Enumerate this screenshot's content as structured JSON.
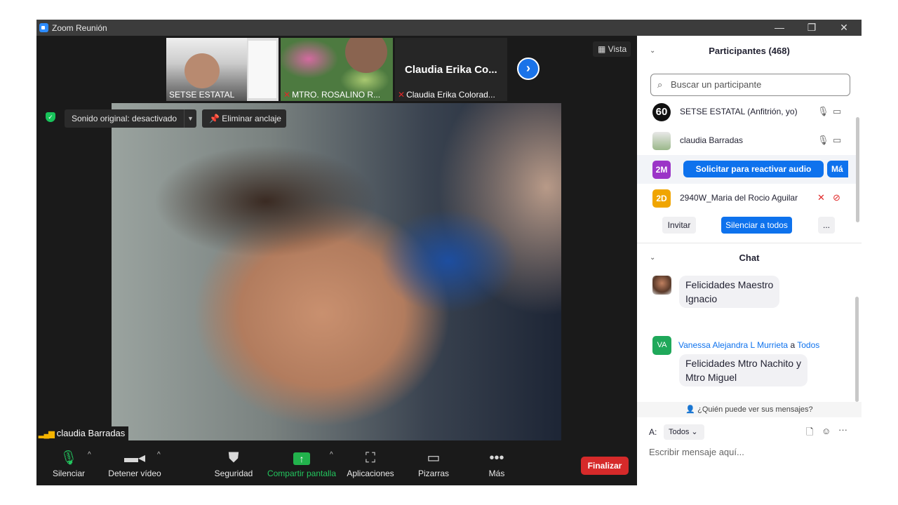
{
  "window": {
    "title": "Zoom Reunión",
    "minimize": "—",
    "restore": "❐",
    "close": "✕"
  },
  "meeting": {
    "view_label": "Vista",
    "thumbnails": [
      {
        "name": "SETSE ESTATAL"
      },
      {
        "name": "MTRO. ROSALINO R..."
      },
      {
        "name": "Claudia Erika Colorad...",
        "display_name": "Claudia  Erika  Co..."
      }
    ],
    "next_arrow": "›",
    "sound_label": "Sonido original: desactivado",
    "unpin_label": "Eliminar anclaje",
    "speaker_name": "claudia  Barradas"
  },
  "toolbar": {
    "mute": "Silenciar",
    "stop_video": "Detener vídeo",
    "security": "Seguridad",
    "share_screen": "Compartir pantalla",
    "apps": "Aplicaciones",
    "whiteboards": "Pizarras",
    "more": "Más",
    "end": "Finalizar"
  },
  "participants": {
    "header": "Participantes (468)",
    "search_placeholder": "Buscar un participante",
    "rows": [
      {
        "avatar_text": "60",
        "avatar_color": "#111111",
        "name": "SETSE ESTATAL (Anfitrión, yo)"
      },
      {
        "avatar_text": "",
        "avatar_color": "#9ab88a",
        "name": "claudia  Barradas"
      },
      {
        "avatar_text": "2M",
        "avatar_color": "#9b34c7",
        "name": ""
      },
      {
        "avatar_text": "2D",
        "avatar_color": "#f0a500",
        "name": "2940W_Maria del Rocio Aguilar"
      }
    ],
    "reactivate_audio": "Solicitar para reactivar audio",
    "more_short": "Má",
    "invite": "Invitar",
    "mute_all": "Silenciar a todos",
    "ellipsis": "..."
  },
  "chat": {
    "header": "Chat",
    "messages": [
      {
        "text_line1": "Felicidades Maestro",
        "text_line2": "Ignacio"
      },
      {
        "sender": "Vanessa Alejandra L Murrieta",
        "connector": "a",
        "recipient": "Todos",
        "avatar_text": "VA",
        "avatar_color": "#1fa85a",
        "text_line1": "Felicidades Mtro Nachito y",
        "text_line2": "Mtro Miguel"
      }
    ],
    "who_sees": "¿Quién puede ver sus mensajes?",
    "to_label": "A:",
    "to_value": "Todos",
    "input_placeholder": "Escribir mensaje aquí..."
  }
}
